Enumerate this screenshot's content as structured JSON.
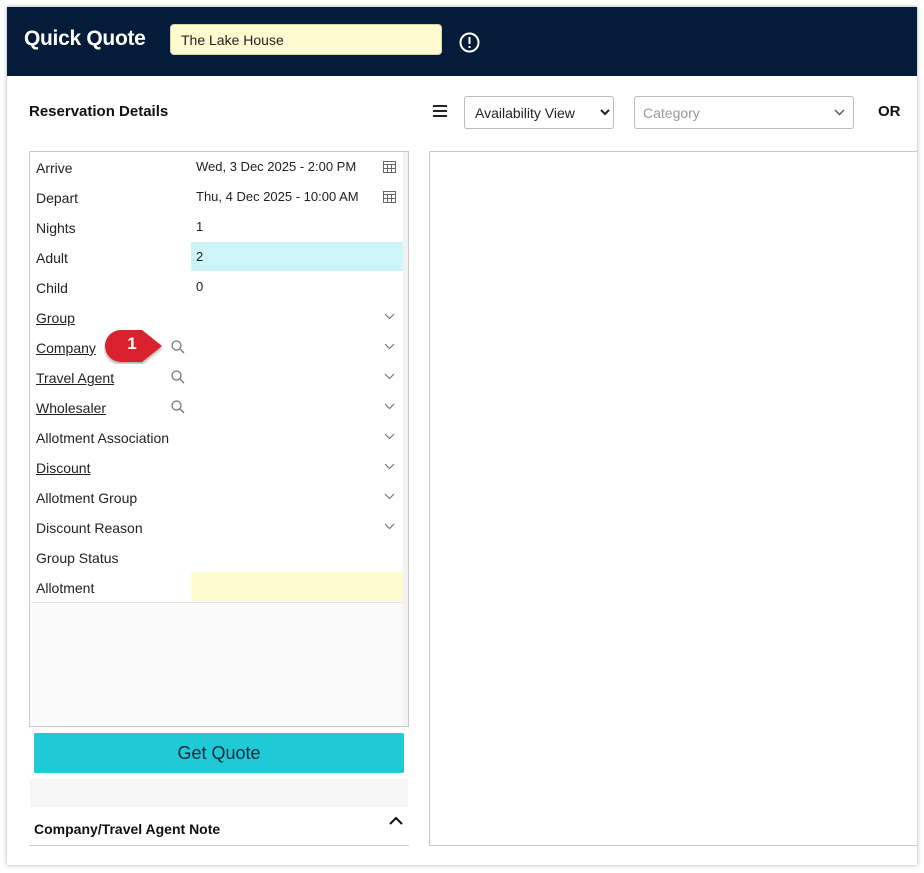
{
  "header": {
    "title": "Quick Quote",
    "property_value": "The Lake House"
  },
  "toolbar": {
    "section_title": "Reservation Details",
    "view_options": [
      "Availability View"
    ],
    "view_selected": "Availability View",
    "category_placeholder": "Category",
    "or_label": "OR"
  },
  "form": {
    "rows": [
      {
        "label": "Arrive",
        "value": "Wed, 3 Dec 2025 - 2:00 PM"
      },
      {
        "label": "Depart",
        "value": "Thu, 4 Dec 2025 - 10:00 AM"
      },
      {
        "label": "Nights",
        "value": "1"
      },
      {
        "label": "Adult",
        "value": "2"
      },
      {
        "label": "Child",
        "value": "0"
      },
      {
        "label": "Group",
        "value": ""
      },
      {
        "label": "Company",
        "value": ""
      },
      {
        "label": "Travel Agent",
        "value": ""
      },
      {
        "label": "Wholesaler",
        "value": ""
      },
      {
        "label": "Allotment Association",
        "value": ""
      },
      {
        "label": "Discount",
        "value": ""
      },
      {
        "label": "Allotment Group",
        "value": ""
      },
      {
        "label": "Discount Reason",
        "value": ""
      },
      {
        "label": "Group Status",
        "value": ""
      },
      {
        "label": "Allotment",
        "value": ""
      }
    ]
  },
  "actions": {
    "get_quote_label": "Get Quote"
  },
  "note": {
    "title": "Company/Travel Agent Note"
  },
  "callout": {
    "number": "1"
  },
  "colors": {
    "header_bg": "#041c3a",
    "accent": "#20c9d6",
    "input_yellow": "#fefbd0",
    "input_cyan": "#cef4f8",
    "callout_red": "#d9232e"
  }
}
